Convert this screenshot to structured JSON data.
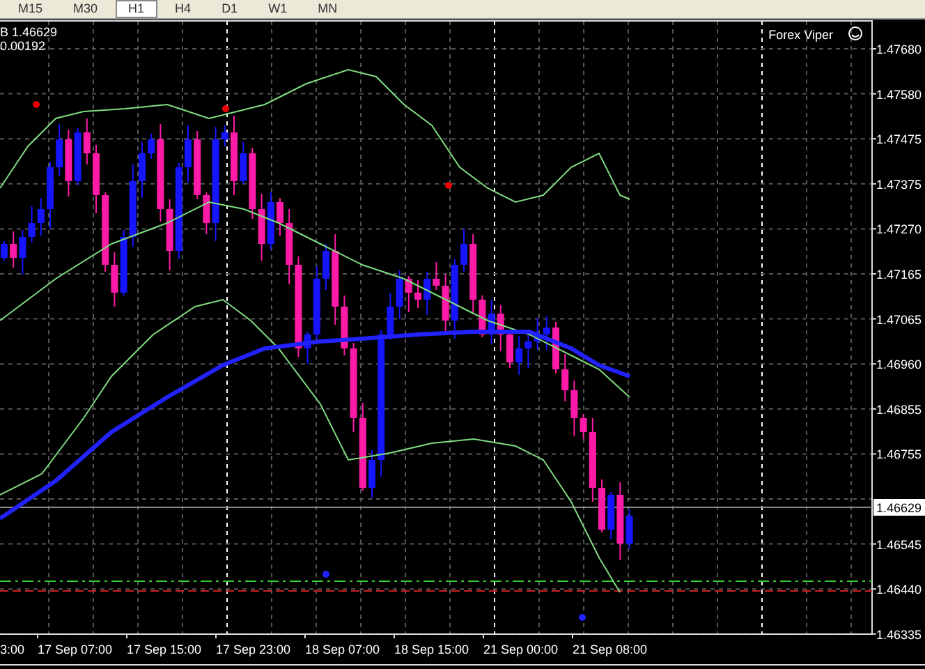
{
  "toolbar": {
    "timeframes": [
      {
        "label": "M15",
        "selected": false
      },
      {
        "label": "M30",
        "selected": false
      },
      {
        "label": "H1",
        "selected": true
      },
      {
        "label": "H4",
        "selected": false
      },
      {
        "label": "D1",
        "selected": false
      },
      {
        "label": "W1",
        "selected": false
      },
      {
        "label": "MN",
        "selected": false
      }
    ]
  },
  "chart": {
    "info_lines": [
      "B 1.46629",
      "0.00192"
    ],
    "indicator_label": "Forex Viper",
    "price_axis": [
      "1.47680",
      "1.47580",
      "1.47475",
      "1.47375",
      "1.47270",
      "1.47165",
      "1.47065",
      "1.46960",
      "1.46855",
      "1.46755",
      "1.46545",
      "1.46440",
      "1.46335"
    ],
    "current_price": "1.46629",
    "time_axis": [
      "3:00",
      "17 Sep 07:00",
      "17 Sep 15:00",
      "17 Sep 23:00",
      "18 Sep 07:00",
      "18 Sep 15:00",
      "21 Sep 00:00",
      "21 Sep 08:00"
    ]
  }
}
